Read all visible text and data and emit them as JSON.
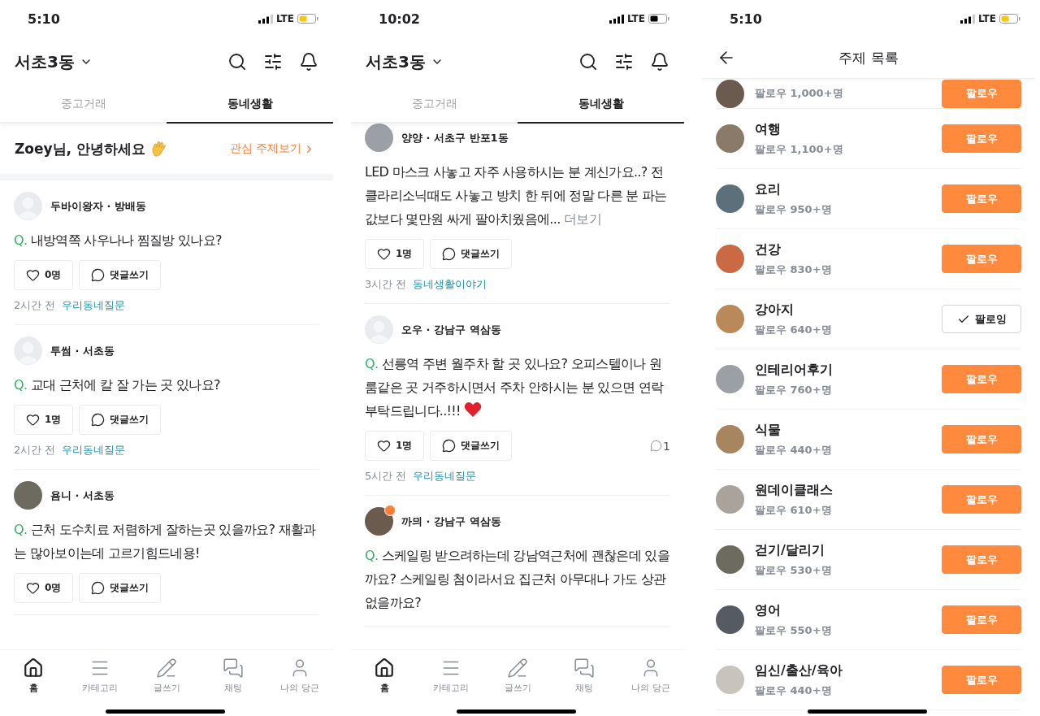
{
  "phones": [
    {
      "kind": "feed",
      "status_bar": {
        "time": "5:10",
        "network": "LTE",
        "low_power_mode": true
      },
      "header": {
        "location": "서초3동"
      },
      "tabs": [
        {
          "label": "중고거래",
          "selected": false
        },
        {
          "label": "동네생활",
          "selected": true
        }
      ],
      "greeting": {
        "text": "Zoey님, 안녕하세요",
        "link": "관심 주제보기"
      },
      "posts": [
        {
          "avatar_photo": false,
          "author": "두바이왕자 · 방배동",
          "prefix": "Q.",
          "body": "내방역쪽 사우나나 찜질방 있나요?",
          "likes": "0명",
          "comment_button": "댓글쓰기",
          "time": "2시간 전",
          "category": "우리동네질문"
        },
        {
          "avatar_photo": false,
          "author": "투썸 · 서초동",
          "prefix": "Q.",
          "body": "교대 근처에 칼 잘 가는 곳 있나요?",
          "likes": "1명",
          "comment_button": "댓글쓰기",
          "time": "2시간 전",
          "category": "우리동네질문"
        },
        {
          "avatar_photo": true,
          "author": "욤니 · 서초동",
          "prefix": "Q.",
          "body": "근처 도수치료 저렴하게 잘하는곳 있을까요? 재활과는 많아보이는데 고르기힘드네용!",
          "likes": "0명",
          "comment_button": "댓글쓰기"
        }
      ],
      "nav": [
        {
          "label": "홈",
          "selected": true
        },
        {
          "label": "카테고리",
          "selected": false
        },
        {
          "label": "글쓰기",
          "selected": false
        },
        {
          "label": "채팅",
          "selected": false
        },
        {
          "label": "나의 당근",
          "selected": false
        }
      ]
    },
    {
      "kind": "feed",
      "status_bar": {
        "time": "10:02",
        "network": "LTE",
        "low_power_mode": false
      },
      "header": {
        "location": "서초3동"
      },
      "tabs": [
        {
          "label": "중고거래",
          "selected": false
        },
        {
          "label": "동네생활",
          "selected": true
        }
      ],
      "posts": [
        {
          "avatar_photo": true,
          "author": "양양 · 서초구 반포1동",
          "body": "LED 마스크 사놓고 자주 사용하시는 분 계신가요..? 전 클라리소닉때도 사놓고 방치 한 뒤에 정말 다른 분 파는 값보다 몇만원 싸게 팔아치웠음에...",
          "more": "더보기",
          "likes": "1명",
          "comment_button": "댓글쓰기",
          "time": "3시간 전",
          "category": "동네생활이야기"
        },
        {
          "avatar_photo": false,
          "author": "오우 · 강남구 역삼동",
          "prefix": "Q.",
          "body": "선릉역 주변 월주차 할 곳 있나요? 오피스텔이나 원룸같은 곳 거주하시면서 주차 안하시는 분 있으면 연락 부탁드립니다..!!!",
          "heart_emoji": true,
          "likes": "1명",
          "comment_button": "댓글쓰기",
          "comment_count": "1",
          "time": "5시간 전",
          "category": "우리동네질문"
        },
        {
          "avatar_photo": true,
          "badge": true,
          "author": "까믜 · 강남구 역삼동",
          "prefix": "Q.",
          "body": "스케일링 받으려하는데 강남역근처에 괜찮은데 있을까요? 스케일링 첨이라서요 집근처 아무대나 가도 상관 없을까요?"
        }
      ],
      "nav": [
        {
          "label": "홈",
          "selected": true
        },
        {
          "label": "카테고리",
          "selected": false
        },
        {
          "label": "글쓰기",
          "selected": false
        },
        {
          "label": "채팅",
          "selected": false
        },
        {
          "label": "나의 당근",
          "selected": false
        }
      ]
    },
    {
      "kind": "topics",
      "status_bar": {
        "time": "5:10",
        "network": "LTE",
        "low_power_mode": true
      },
      "title": "주제 목록",
      "topics": [
        {
          "followers": "팔로우 1,000+명",
          "button": "팔로우",
          "following": false
        },
        {
          "name": "여행",
          "followers": "팔로우 1,100+명",
          "button": "팔로우",
          "following": false
        },
        {
          "name": "요리",
          "followers": "팔로우 950+명",
          "button": "팔로우",
          "following": false
        },
        {
          "name": "건강",
          "followers": "팔로우 830+명",
          "button": "팔로우",
          "following": false
        },
        {
          "name": "강아지",
          "followers": "팔로우 640+명",
          "button": "팔로잉",
          "following": true
        },
        {
          "name": "인테리어후기",
          "followers": "팔로우 760+명",
          "button": "팔로우",
          "following": false
        },
        {
          "name": "식물",
          "followers": "팔로우 440+명",
          "button": "팔로우",
          "following": false
        },
        {
          "name": "원데이클래스",
          "followers": "팔로우 610+명",
          "button": "팔로우",
          "following": false
        },
        {
          "name": "걷기/달리기",
          "followers": "팔로우 530+명",
          "button": "팔로우",
          "following": false
        },
        {
          "name": "영어",
          "followers": "팔로우 550+명",
          "button": "팔로우",
          "following": false
        },
        {
          "name": "임신/출산/육아",
          "followers": "팔로우 440+명",
          "button": "팔로우",
          "following": false
        }
      ]
    }
  ]
}
